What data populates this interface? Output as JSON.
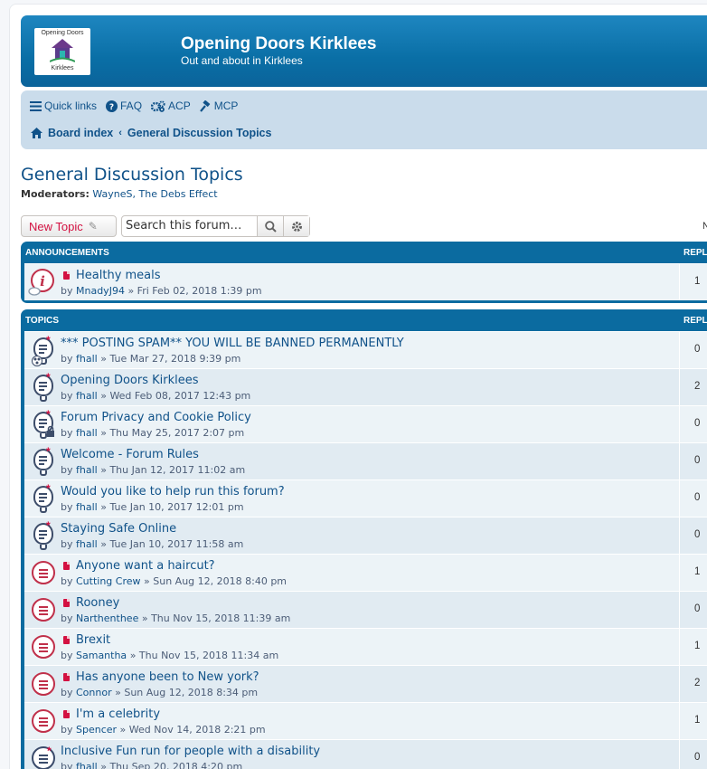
{
  "header": {
    "logo_top": "Opening Doors",
    "logo_bottom": "Kirklees",
    "site_title": "Opening Doors Kirklees",
    "site_description": "Out and about in Kirklees"
  },
  "nav": {
    "quick_links": "Quick links",
    "faq": "FAQ",
    "acp": "ACP",
    "mcp": "MCP",
    "breadcrumb_home": "Board index",
    "breadcrumb_current": "General Discussion Topics"
  },
  "forum": {
    "title": "General Discussion Topics",
    "moderators_label": "Moderators:",
    "moderators": "WayneS, The Debs Effect",
    "new_topic": "New Topic",
    "search_placeholder": "Search this forum…",
    "pagination_fragment": "N"
  },
  "announcements": {
    "header": "ANNOUNCEMENTS",
    "replies_header": "REPLI",
    "rows": [
      {
        "title": "Healthy meals",
        "author": "MnadyJ94",
        "date": "Fri Feb 02, 2018 1:39 pm",
        "replies": "1"
      }
    ]
  },
  "topics": {
    "header": "TOPICS",
    "replies_header": "REPLI",
    "rows": [
      {
        "title": "*** POSTING SPAM** YOU WILL BE BANNED PERMANENTLY",
        "author": "fhall",
        "date": "Tue Mar 27, 2018 9:39 pm",
        "replies": "0"
      },
      {
        "title": "Opening Doors Kirklees",
        "author": "fhall",
        "date": "Wed Feb 08, 2017 12:43 pm",
        "replies": "2"
      },
      {
        "title": "Forum Privacy and Cookie Policy",
        "author": "fhall",
        "date": "Thu May 25, 2017 2:07 pm",
        "replies": "0"
      },
      {
        "title": "Welcome - Forum Rules",
        "author": "fhall",
        "date": "Thu Jan 12, 2017 11:02 am",
        "replies": "0"
      },
      {
        "title": "Would you like to help run this forum?",
        "author": "fhall",
        "date": "Tue Jan 10, 2017 12:01 pm",
        "replies": "0"
      },
      {
        "title": "Staying Safe Online",
        "author": "fhall",
        "date": "Tue Jan 10, 2017 11:58 am",
        "replies": "0"
      },
      {
        "title": "Anyone want a haircut?",
        "author": "Cutting Crew",
        "date": "Sun Aug 12, 2018 8:40 pm",
        "replies": "1"
      },
      {
        "title": "Rooney",
        "author": "Narthenthee",
        "date": "Thu Nov 15, 2018 11:39 am",
        "replies": "0"
      },
      {
        "title": "Brexit",
        "author": "Samantha",
        "date": "Thu Nov 15, 2018 11:34 am",
        "replies": "1"
      },
      {
        "title": "Has anyone been to New york?",
        "author": "Connor",
        "date": "Sun Aug 12, 2018 8:34 pm",
        "replies": "2"
      },
      {
        "title": "I'm a celebrity",
        "author": "Spencer",
        "date": "Wed Nov 14, 2018 2:21 pm",
        "replies": "1"
      },
      {
        "title": "Inclusive Fun run for people with a disability",
        "author": "fhall",
        "date": "Thu Sep 20, 2018 4:20 pm",
        "replies": "0"
      }
    ]
  },
  "by_word": "by",
  "separator": "»",
  "colors": {
    "header_blue": "#0b6ba0",
    "nav_bg": "#cadceb",
    "link": "#105289",
    "accent_red": "#d31141"
  }
}
